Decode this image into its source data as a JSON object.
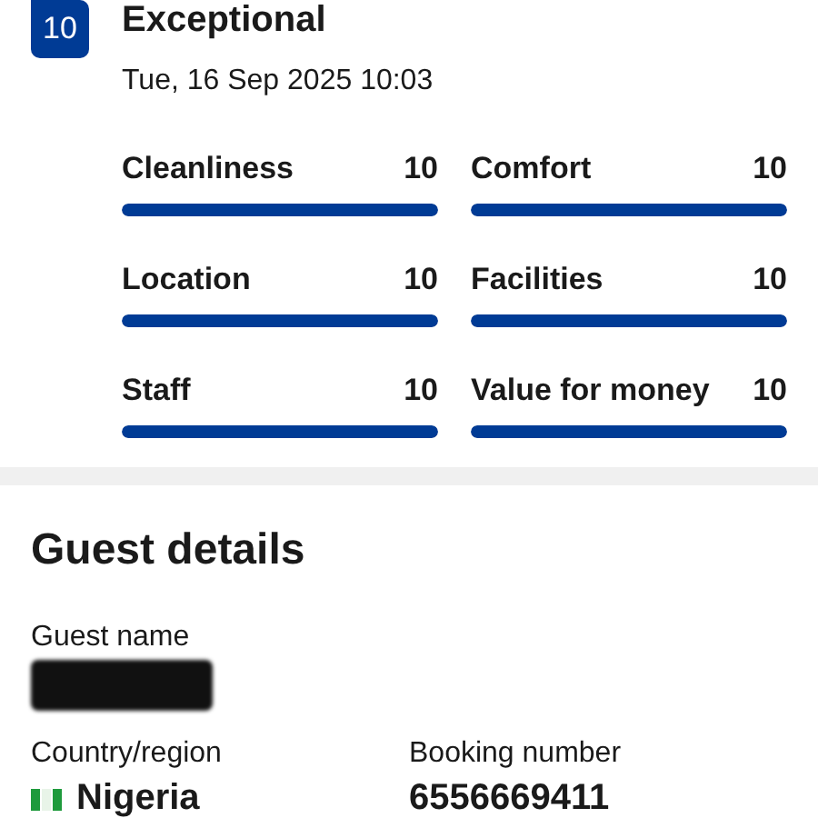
{
  "review": {
    "score": "10",
    "rating": "Exceptional",
    "date": "Tue, 16 Sep 2025 10:03",
    "categories": [
      {
        "label": "Cleanliness",
        "score": "10",
        "level": 1
      },
      {
        "label": "Comfort",
        "score": "10",
        "level": 1
      },
      {
        "label": "Location",
        "score": "10",
        "level": 1
      },
      {
        "label": "Facilities",
        "score": "10",
        "level": 1
      },
      {
        "label": "Staff",
        "score": "10",
        "level": 1
      },
      {
        "label": "Value for money",
        "score": "10",
        "level": 1
      }
    ]
  },
  "guest_details": {
    "title": "Guest details",
    "guest_name": {
      "label": "Guest name",
      "redacted": true
    },
    "country": {
      "label": "Country/region",
      "value": "Nigeria"
    },
    "booking_number": {
      "label": "Booking number",
      "value": "6556669411"
    }
  }
}
